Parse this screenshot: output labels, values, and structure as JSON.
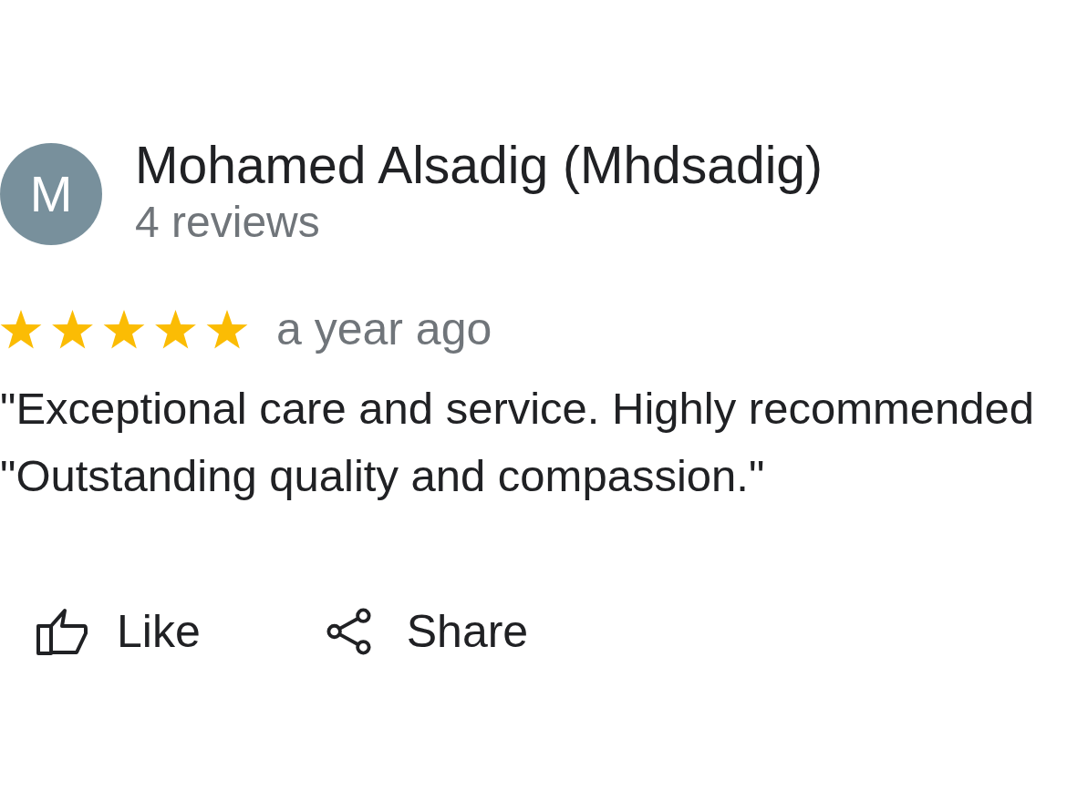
{
  "review": {
    "author": {
      "avatar_letter": "M",
      "name": "Mohamed Alsadig (Mhdsadig)",
      "reviews_count": "4 reviews"
    },
    "stars": 5,
    "time": "a year ago",
    "text_lines": [
      "\"Exceptional care and service. Highly recommended",
      "\"Outstanding quality and compassion.\""
    ]
  },
  "actions": [
    {
      "kind": "like",
      "label": "Like"
    },
    {
      "kind": "share",
      "label": "Share"
    }
  ]
}
